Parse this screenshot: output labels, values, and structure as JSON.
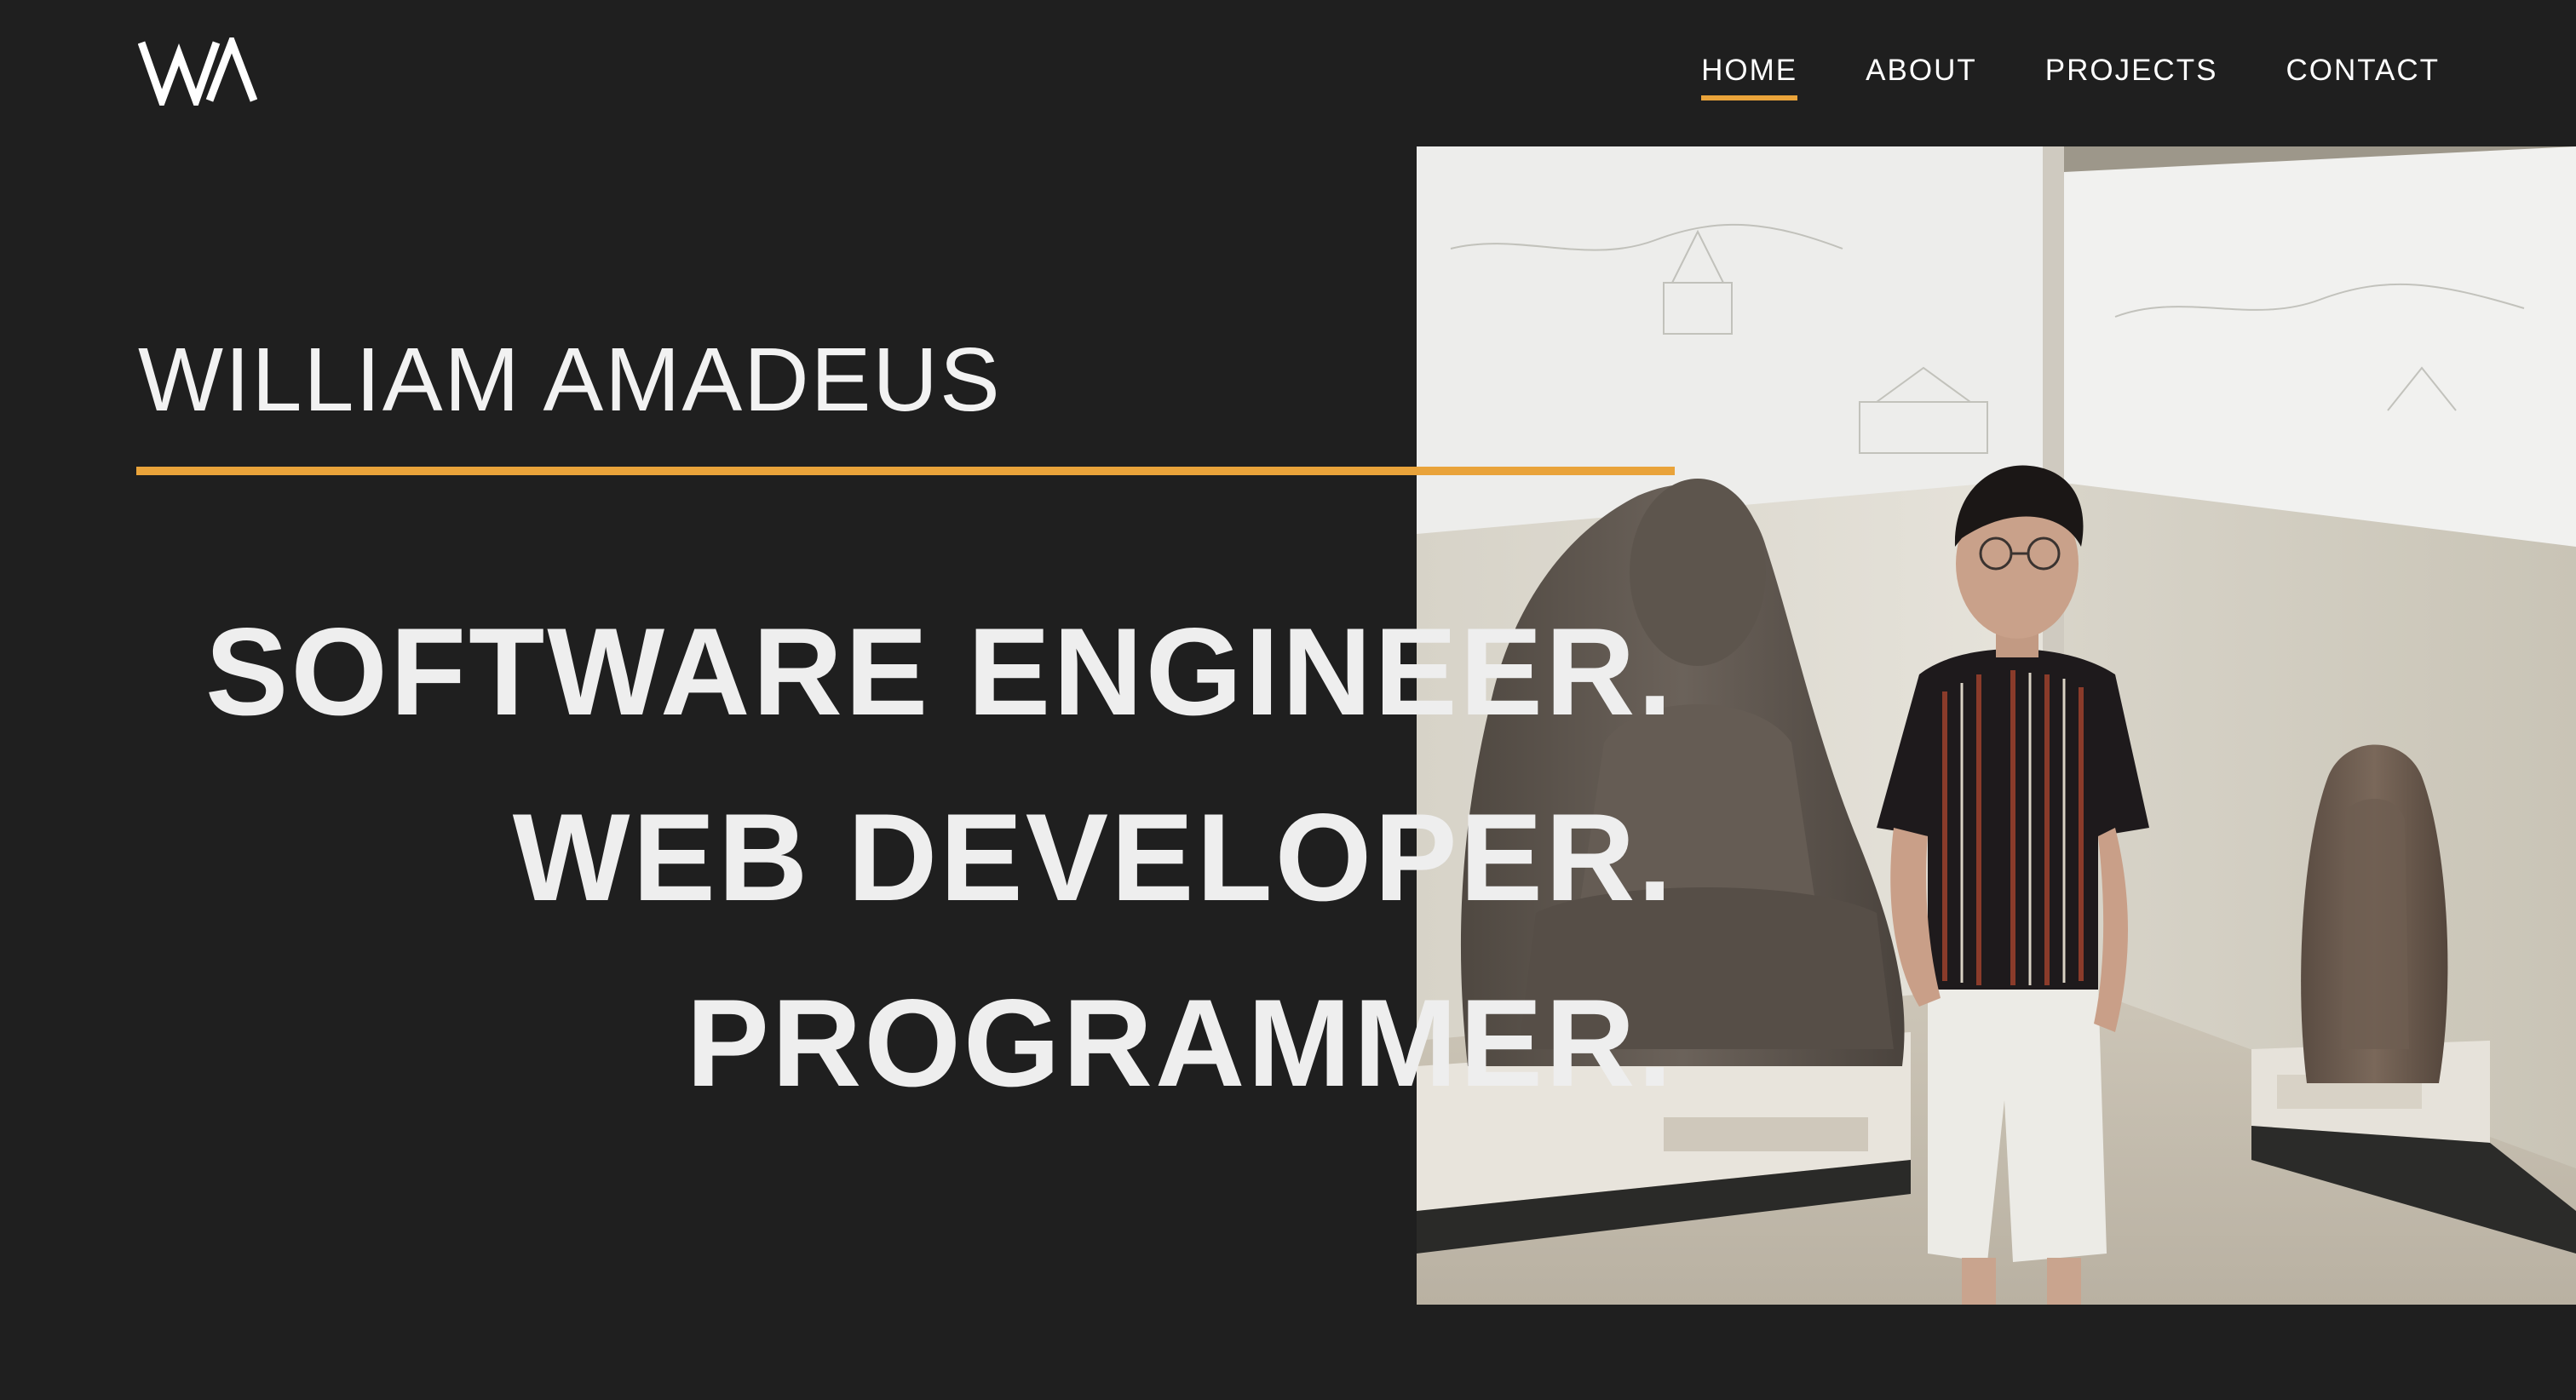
{
  "logo": {
    "text": "WA",
    "icon": "wa-monogram-logo"
  },
  "nav": {
    "items": [
      {
        "label": "HOME",
        "active": true
      },
      {
        "label": "ABOUT",
        "active": false
      },
      {
        "label": "PROJECTS",
        "active": false
      },
      {
        "label": "CONTACT",
        "active": false
      }
    ]
  },
  "hero": {
    "name": "WILLIAM AMADEUS",
    "roles": [
      "SOFTWARE ENGINEER.",
      "WEB DEVELOPER.",
      "PROGRAMMER."
    ],
    "photo": {
      "subject": "portrait-photo"
    }
  },
  "colors": {
    "background": "#1f1f1f",
    "accent": "#e9a33a",
    "text": "#ffffff"
  }
}
